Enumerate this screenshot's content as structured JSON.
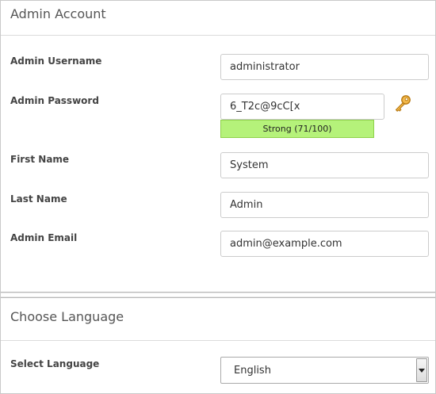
{
  "admin_account": {
    "title": "Admin Account",
    "username": {
      "label": "Admin Username",
      "value": "administrator"
    },
    "password": {
      "label": "Admin Password",
      "value": "6_T2c@9cC[x",
      "strength_text": "Strong (71/100)",
      "strength_color": "#b5f27a",
      "generate_icon": "key-icon"
    },
    "first_name": {
      "label": "First Name",
      "value": "System"
    },
    "last_name": {
      "label": "Last Name",
      "value": "Admin"
    },
    "email": {
      "label": "Admin Email",
      "value": "admin@example.com"
    }
  },
  "language": {
    "title": "Choose Language",
    "select_label": "Select Language",
    "selected": "English",
    "arrow_icon": "chevron-down-icon"
  }
}
